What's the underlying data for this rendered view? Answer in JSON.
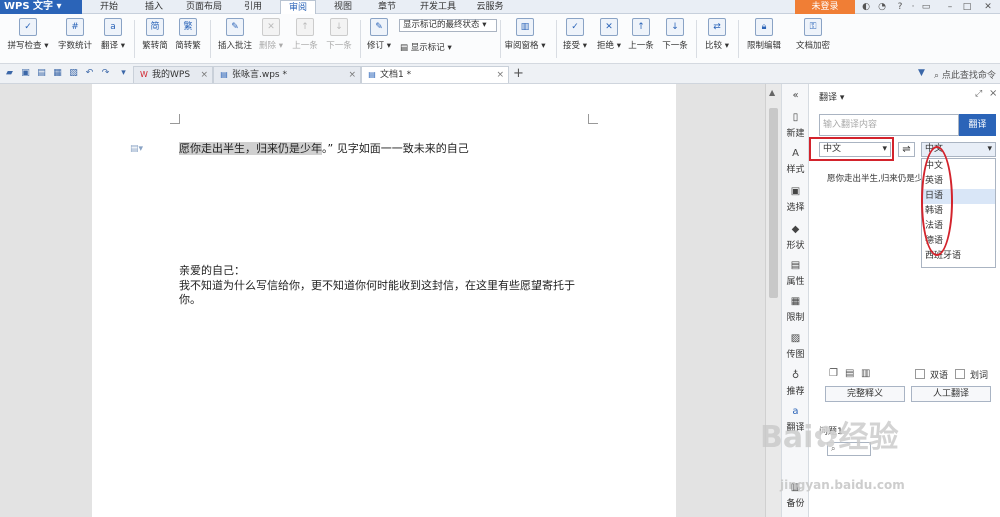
{
  "menubar": {
    "app_name": "WPS 文字",
    "tabs": [
      "开始",
      "插入",
      "页面布局",
      "引用",
      "审阅",
      "视图",
      "章节",
      "开发工具",
      "云服务"
    ],
    "active_tab": "审阅",
    "login": "未登录"
  },
  "ribbon": {
    "spell_check": "拼写检查",
    "word_count": "字数统计",
    "translate": "翻译",
    "to_simplified": "繁转简",
    "to_traditional": "简转繁",
    "insert_comment": "插入批注",
    "delete": "删除",
    "prev_comment": "上一条",
    "next_comment": "下一条",
    "revise": "修订",
    "markup_state": "显示标记的最终状态",
    "show_markup": "显示标记",
    "review_pane": "审阅窗格",
    "accept": "接受",
    "reject": "拒绝",
    "prev_change": "上一条",
    "next_change": "下一条",
    "compare": "比较",
    "restrict_edit": "限制编辑",
    "doc_encrypt": "文档加密"
  },
  "tabbar": {
    "tabs": [
      {
        "label": "我的WPS",
        "active": false
      },
      {
        "label": "张咏言.wps *",
        "active": false
      },
      {
        "label": "文档1 *",
        "active": true
      }
    ],
    "add": "+",
    "search_placeholder": "点此查找命令"
  },
  "document": {
    "line1_highlight": "愿你走出半生，归来仍是少年",
    "line1_rest": "。” 见字如面一一致未来的自己",
    "greeting": "亲爱的自己：",
    "body": "我不知道为什么写信给你，更不知道你何时能收到这封信，在这里有些愿望寄托于你。"
  },
  "side_strip": [
    "新建",
    "样式",
    "选择",
    "形状",
    "属性",
    "限制",
    "传图",
    "推荐",
    "翻译",
    "备份"
  ],
  "panel": {
    "title": "翻译",
    "input_placeholder": "输入翻译内容",
    "translate_button": "翻译",
    "source_lang": "中文",
    "target_lang": "中文",
    "result_text": "愿你走出半生,归来仍是少",
    "language_options": [
      "中文",
      "英语",
      "日语",
      "韩语",
      "法语",
      "德语",
      "西班牙语"
    ],
    "highlighted_option": "日语",
    "bilingual": "双语",
    "underline": "划词",
    "full_definition": "完整释义",
    "human_translate": "人工翻译",
    "section_label": "问题1"
  },
  "watermark": {
    "logo": "Bai",
    "brand": "经验",
    "url": "jingyan.baidu.com"
  },
  "colors": {
    "accent": "#2b64b8",
    "highlight_red": "#d3232c",
    "login_orange": "#f07e35"
  }
}
